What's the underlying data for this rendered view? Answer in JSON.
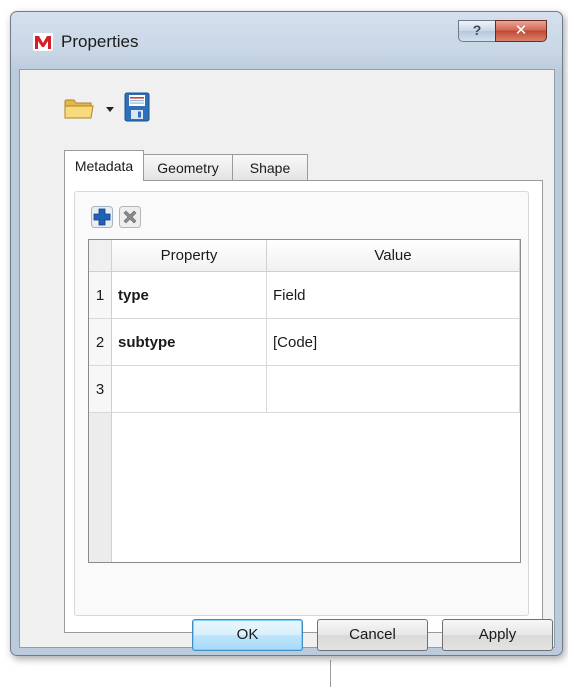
{
  "window": {
    "title": "Properties",
    "help_glyph": "?",
    "close_glyph": "✕"
  },
  "toolbar": {
    "open_icon": "folder-open-icon",
    "save_icon": "floppy-save-icon"
  },
  "tabs": [
    {
      "label": "Metadata",
      "active": true
    },
    {
      "label": "Geometry",
      "active": false
    },
    {
      "label": "Shape",
      "active": false
    }
  ],
  "panel": {
    "add_icon": "plus-icon",
    "remove_icon": "delete-x-icon"
  },
  "table": {
    "columns": [
      "Property",
      "Value"
    ],
    "rows": [
      {
        "num": "1",
        "property": "type",
        "value": "Field"
      },
      {
        "num": "2",
        "property": "subtype",
        "value": "[Code]"
      },
      {
        "num": "3",
        "property": "",
        "value": ""
      }
    ]
  },
  "buttons": {
    "ok": "OK",
    "cancel": "Cancel",
    "apply": "Apply"
  },
  "colors": {
    "accent": "#3b8ec9",
    "close": "#c04a33"
  }
}
